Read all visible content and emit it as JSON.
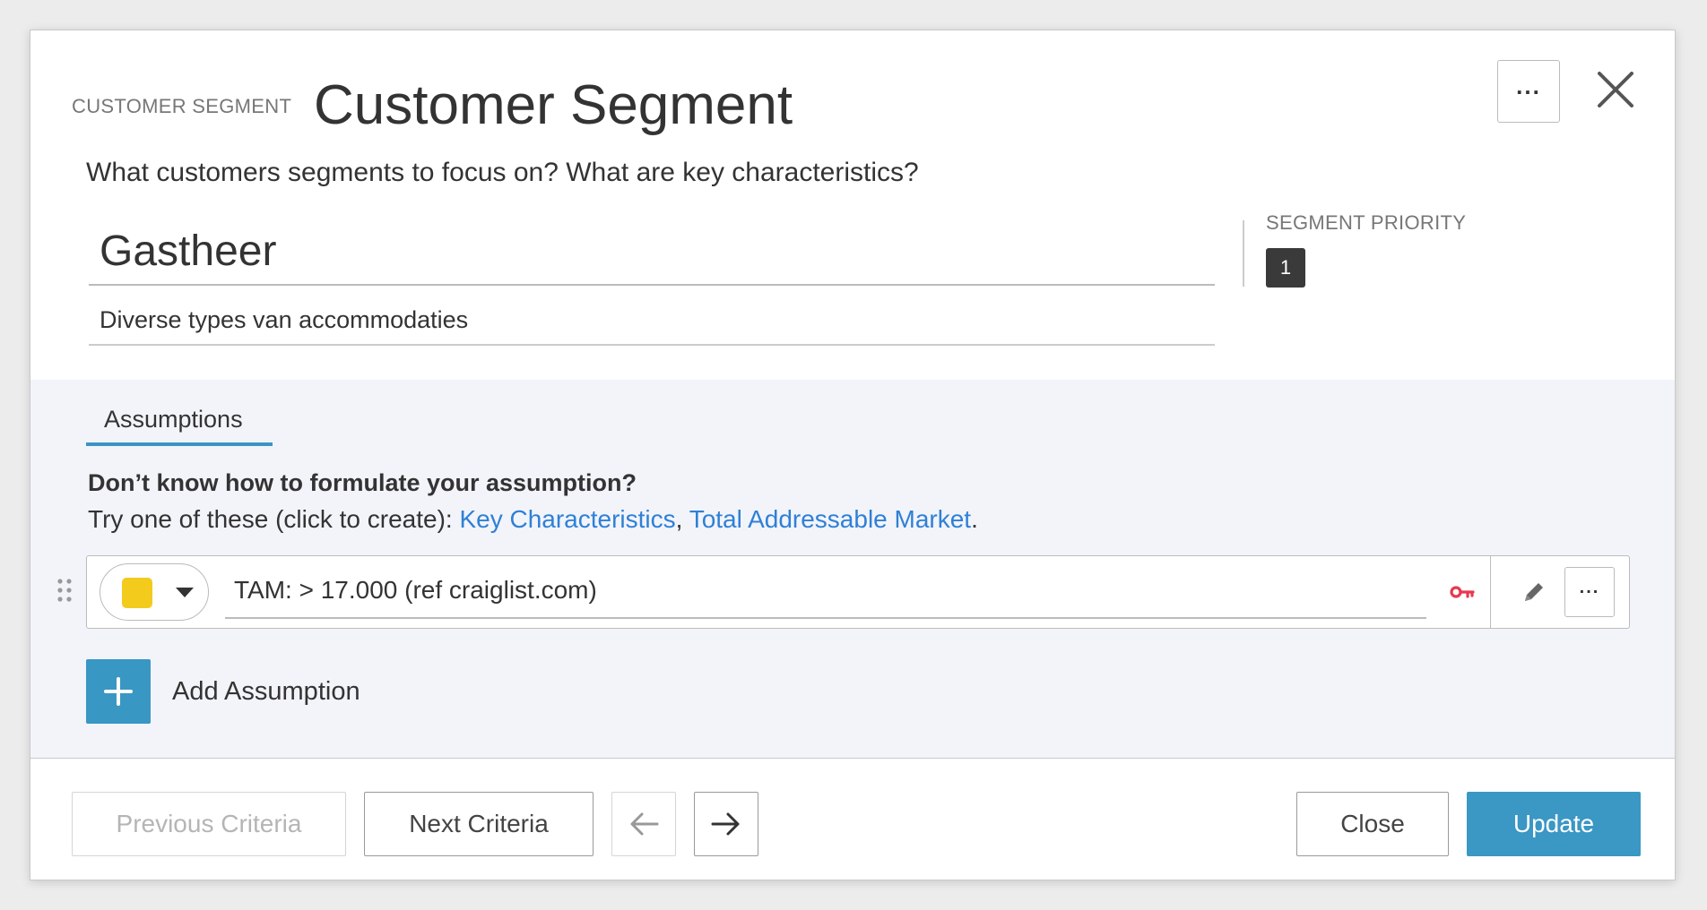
{
  "header": {
    "small_label": "CUSTOMER SEGMENT",
    "title": "Customer Segment"
  },
  "question": "What customers segments to focus on? What are key characteristics?",
  "segment": {
    "name": "Gastheer",
    "description": "Diverse types van accommodaties",
    "priority_label": "SEGMENT PRIORITY",
    "priority_value": "1"
  },
  "assumptions": {
    "tab_label": "Assumptions",
    "hint_title": "Don’t know how to formulate your assumption?",
    "hint_prefix": "Try one of these (click to create): ",
    "hint_links": [
      "Key Characteristics",
      "Total Addressable Market"
    ],
    "items": [
      {
        "text": "TAM: > 17.000 (ref craiglist.com)",
        "color": "#f2cb1d",
        "key_icon": "key-icon",
        "key_color": "#e8384f"
      }
    ],
    "add_label": "Add Assumption"
  },
  "footer": {
    "previous_label": "Previous Criteria",
    "next_label": "Next Criteria",
    "close_label": "Close",
    "update_label": "Update"
  },
  "colors": {
    "accent": "#3b97c3",
    "link": "#2f80d6",
    "panel_bg": "#f2f4fa"
  },
  "icons": [
    "more-icon",
    "close-icon",
    "drag-handle-icon",
    "chevron-down-icon",
    "key-icon",
    "pencil-icon",
    "plus-icon",
    "arrow-left-icon",
    "arrow-right-icon"
  ]
}
